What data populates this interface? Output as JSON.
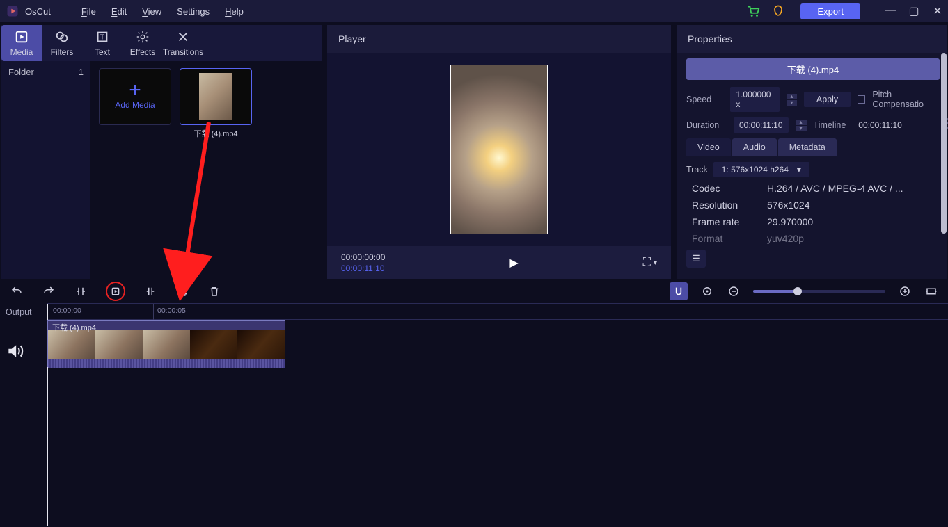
{
  "titlebar": {
    "app_name": "OsCut",
    "menus": {
      "file": "File",
      "edit": "Edit",
      "view": "View",
      "settings": "Settings",
      "help": "Help"
    },
    "export_label": "Export"
  },
  "tool_tabs": {
    "media": "Media",
    "filters": "Filters",
    "text": "Text",
    "effects": "Effects",
    "transitions": "Transitions"
  },
  "folder_pane": {
    "label": "Folder",
    "count": "1"
  },
  "media": {
    "add_label": "Add Media",
    "clip_caption": "下载 (4).mp4"
  },
  "player": {
    "title": "Player",
    "time_current": "00:00:00:00",
    "time_duration": "00:00:11:10"
  },
  "properties": {
    "title": "Properties",
    "file_chip": "下载 (4).mp4",
    "speed_label": "Speed",
    "speed_value": "1.000000 x",
    "apply_label": "Apply",
    "pitch_label": "Pitch Compensatio",
    "duration_label": "Duration",
    "duration_value": "00:00:11:10",
    "timeline_label": "Timeline",
    "timeline_value": "00:00:11:10",
    "tabs": {
      "video": "Video",
      "audio": "Audio",
      "metadata": "Metadata"
    },
    "track_label": "Track",
    "track_value": "1: 576x1024 h264",
    "kv": {
      "codec_k": "Codec",
      "codec_v": "H.264 / AVC / MPEG-4 AVC / ...",
      "res_k": "Resolution",
      "res_v": "576x1024",
      "fps_k": "Frame rate",
      "fps_v": "29.970000",
      "fmt_k": "Format",
      "fmt_v": "yuv420p"
    }
  },
  "timeline": {
    "output_label": "Output",
    "ruler_t0": "00:00:00",
    "ruler_t1": "00:00:05",
    "clip_label": "下载 (4).mp4"
  }
}
